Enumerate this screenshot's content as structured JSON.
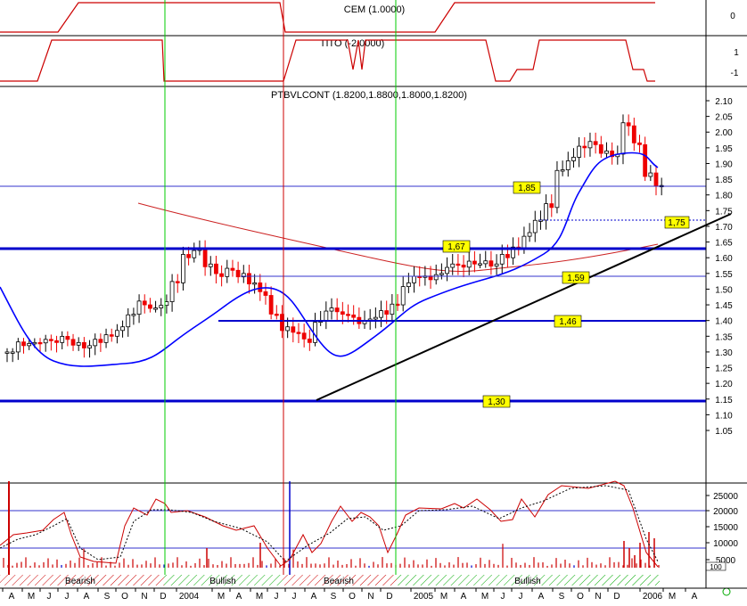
{
  "colors": {
    "background": "#ffffff",
    "frame": "#000000",
    "indicator_line": "#cc0000",
    "level_line": "#0000cc",
    "thin_level_line": "#3333cc",
    "moving_avg_short": "#0000ff",
    "moving_avg_long": "#cc2222",
    "trendline": "#000000",
    "vertical_marker_green": "#00cc00",
    "vertical_marker_red": "#cc0000",
    "label_fill": "#ffff00",
    "candle_up": "#000000",
    "candle_down": "#ee0000",
    "oscillator_line": "#cc0000",
    "volume_bar": "#cc0000",
    "volume_spike": "#0000cc",
    "bearish_band": "#cc0000",
    "bullish_band": "#00aa00"
  },
  "panels": {
    "cem": {
      "label": "CEM (1.0000)",
      "ticks": [
        "0"
      ]
    },
    "tito": {
      "label": "TITO (-2.0000)",
      "ticks": [
        "1",
        "-1"
      ]
    },
    "price": {
      "label": "PTBVLCONT (1.8200,1.8800,1.8000,1.8200)"
    },
    "volume": {
      "scale_box": "100"
    }
  },
  "chart_data": {
    "type": "candlestick",
    "title": "PTBVLCONT (1.8200,1.8800,1.8000,1.8200)",
    "y_ticks": [
      "2.10",
      "2.05",
      "2.00",
      "1.95",
      "1.90",
      "1.85",
      "1.80",
      "1.75",
      "1.70",
      "1.65",
      "1.60",
      "1.55",
      "1.50",
      "1.45",
      "1.40",
      "1.35",
      "1.30",
      "1.25",
      "1.20",
      "1.15",
      "1.10",
      "1.05"
    ],
    "ylim": [
      1.05,
      2.1
    ],
    "volume_ticks": [
      "25000",
      "20000",
      "15000",
      "10000",
      "5000"
    ],
    "x_labels": [
      "A",
      "M",
      "J",
      "J",
      "A",
      "S",
      "O",
      "N",
      "D",
      "2004",
      "M",
      "A",
      "M",
      "J",
      "J",
      "A",
      "S",
      "O",
      "N",
      "D",
      "2005",
      "M",
      "A",
      "M",
      "J",
      "J",
      "A",
      "S",
      "O",
      "N",
      "D",
      "2006",
      "M",
      "A"
    ],
    "level_labels": [
      "1,85",
      "1,67",
      "1,59",
      "1,46",
      "1,30",
      "1,75"
    ],
    "levels": [
      1.85,
      1.67,
      1.59,
      1.46,
      1.3,
      1.75
    ],
    "band_labels": [
      "Bearish",
      "Bullish",
      "Bearish",
      "Bullish"
    ],
    "price_path": [
      1.3,
      1.32,
      1.33,
      1.34,
      1.33,
      1.34,
      1.33,
      1.32,
      1.33,
      1.35,
      1.38,
      1.42,
      1.45,
      1.44,
      1.46,
      1.52,
      1.6,
      1.63,
      1.58,
      1.54,
      1.56,
      1.55,
      1.52,
      1.48,
      1.42,
      1.38,
      1.36,
      1.33,
      1.4,
      1.44,
      1.42,
      1.41,
      1.4,
      1.41,
      1.42,
      1.45,
      1.52,
      1.54,
      1.53,
      1.55,
      1.58,
      1.57,
      1.58,
      1.59,
      1.58,
      1.6,
      1.63,
      1.68,
      1.72,
      1.76,
      1.88,
      1.92,
      1.95,
      1.96,
      1.94,
      1.93,
      2.02,
      1.96,
      1.87,
      1.83
    ]
  }
}
